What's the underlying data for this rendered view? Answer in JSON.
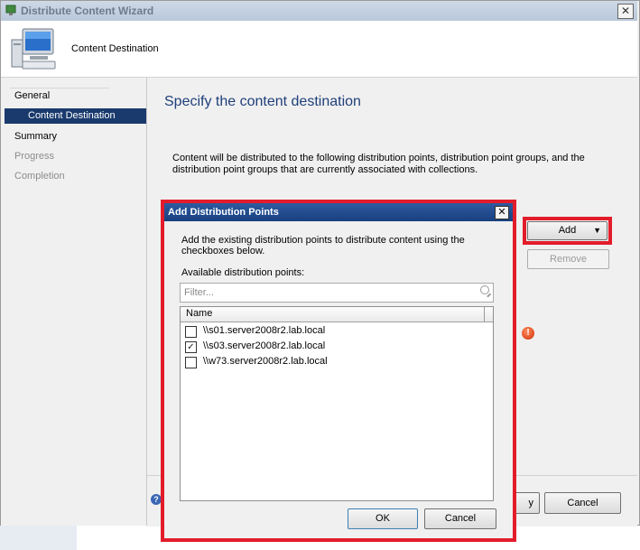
{
  "window": {
    "title": "Distribute Content Wizard",
    "close_glyph": "✕",
    "page_header": "Content Destination"
  },
  "nav": {
    "items": [
      {
        "label": "General",
        "state": "normal"
      },
      {
        "label": "Content Destination",
        "state": "selected"
      },
      {
        "label": "Summary",
        "state": "normal"
      },
      {
        "label": "Progress",
        "state": "disabled"
      },
      {
        "label": "Completion",
        "state": "disabled"
      }
    ]
  },
  "main": {
    "heading": "Specify the content destination",
    "description": "Content will be distributed to the following distribution points, distribution point groups, and the distribution point groups that are currently associated with collections.",
    "add_button": "Add",
    "add_arrow": "▼",
    "remove_button": "Remove",
    "warning_glyph": "!"
  },
  "bottom": {
    "help_glyph": "?",
    "next_fragment": "y",
    "cancel_button": "Cancel"
  },
  "dialog": {
    "title": "Add Distribution Points",
    "close_glyph": "✕",
    "instructions": "Add the existing distribution points to distribute content using the checkboxes below.",
    "available_label": "Available distribution points:",
    "filter_placeholder": "Filter...",
    "column_name": "Name",
    "rows": [
      {
        "label": "\\\\s01.server2008r2.lab.local",
        "checked": false,
        "mark": ""
      },
      {
        "label": "\\\\s03.server2008r2.lab.local",
        "checked": true,
        "mark": "✓"
      },
      {
        "label": "\\\\w73.server2008r2.lab.local",
        "checked": false,
        "mark": ""
      }
    ],
    "ok_button": "OK",
    "cancel_button": "Cancel"
  },
  "colors": {
    "selection": "#1a3a6d",
    "heading": "#1f3f7a",
    "highlight_red": "#e21c2a",
    "dialog_title": "#17407f"
  }
}
